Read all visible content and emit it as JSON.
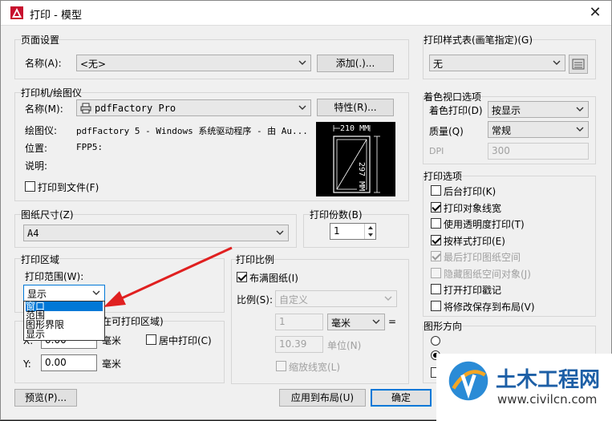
{
  "window": {
    "title": "打印 - 模型",
    "close": "✕"
  },
  "page_setup": {
    "group_label": "页面设置",
    "name_label": "名称(A):",
    "name_value": "<无>",
    "add_button": "添加(.)..."
  },
  "printer": {
    "group_label": "打印机/绘图仪",
    "name_label": "名称(M):",
    "name_value": "pdfFactory Pro",
    "properties_button": "特性(R)...",
    "plotter_label": "绘图仪:",
    "plotter_value": "pdfFactory 5 - Windows 系统驱动程序 - 由 Au...",
    "location_label": "位置:",
    "location_value": "FPP5:",
    "desc_label": "说明:",
    "print_to_file": "打印到文件(F)",
    "preview_width": "210 MM",
    "preview_height": "297 MM"
  },
  "paper": {
    "group_label": "图纸尺寸(Z)",
    "value": "A4"
  },
  "copies": {
    "group_label": "打印份数(B)",
    "value": "1"
  },
  "area": {
    "group_label": "打印区域",
    "range_label": "打印范围(W):",
    "range_value": "显示",
    "options": [
      "窗口",
      "范围",
      "图形界限",
      "显示"
    ]
  },
  "offset": {
    "group_label_visible": "在可打印区域)",
    "x_prefix": "X:",
    "x_unit": "毫米",
    "center_label": "居中打印(C)",
    "y_label": "Y:",
    "y_value": "0.00",
    "y_unit": "毫米",
    "partial_x_value": "0.00"
  },
  "scale": {
    "group_label": "打印比例",
    "fit_label": "布满图纸(I)",
    "ratio_label": "比例(S):",
    "ratio_value": "自定义",
    "num_value": "1",
    "unit_value": "毫米",
    "equals": "=",
    "denom_value": "10.39",
    "denom_unit": "单位(N)",
    "lineweight_label": "缩放线宽(L)"
  },
  "style_table": {
    "group_label": "打印样式表(画笔指定)(G)",
    "value": "无"
  },
  "shaded": {
    "group_label": "着色视口选项",
    "shade_label": "着色打印(D)",
    "shade_value": "按显示",
    "quality_label": "质量(Q)",
    "quality_value": "常规",
    "dpi_label": "DPI",
    "dpi_value": "300"
  },
  "options": {
    "group_label": "打印选项",
    "items": [
      {
        "label": "后台打印(K)",
        "checked": false,
        "disabled": false
      },
      {
        "label": "打印对象线宽",
        "checked": true,
        "disabled": false
      },
      {
        "label": "使用透明度打印(T)",
        "checked": false,
        "disabled": false
      },
      {
        "label": "按样式打印(E)",
        "checked": true,
        "disabled": false
      },
      {
        "label": "最后打印图纸空间",
        "checked": true,
        "disabled": true
      },
      {
        "label": "隐藏图纸空间对象(J)",
        "checked": false,
        "disabled": true
      },
      {
        "label": "打开打印戳记",
        "checked": false,
        "disabled": false
      },
      {
        "label": "将修改保存到布局(V)",
        "checked": false,
        "disabled": false
      }
    ]
  },
  "orientation": {
    "group_label": "图形方向"
  },
  "footer": {
    "preview_button": "预览(P)...",
    "apply_button": "应用到布局(U)",
    "ok_button": "确定"
  },
  "watermark": {
    "title": "土木工程网",
    "url": "www.civilcn.com"
  },
  "colors": {
    "accent": "#0078d7",
    "arrow": "#e02020"
  }
}
